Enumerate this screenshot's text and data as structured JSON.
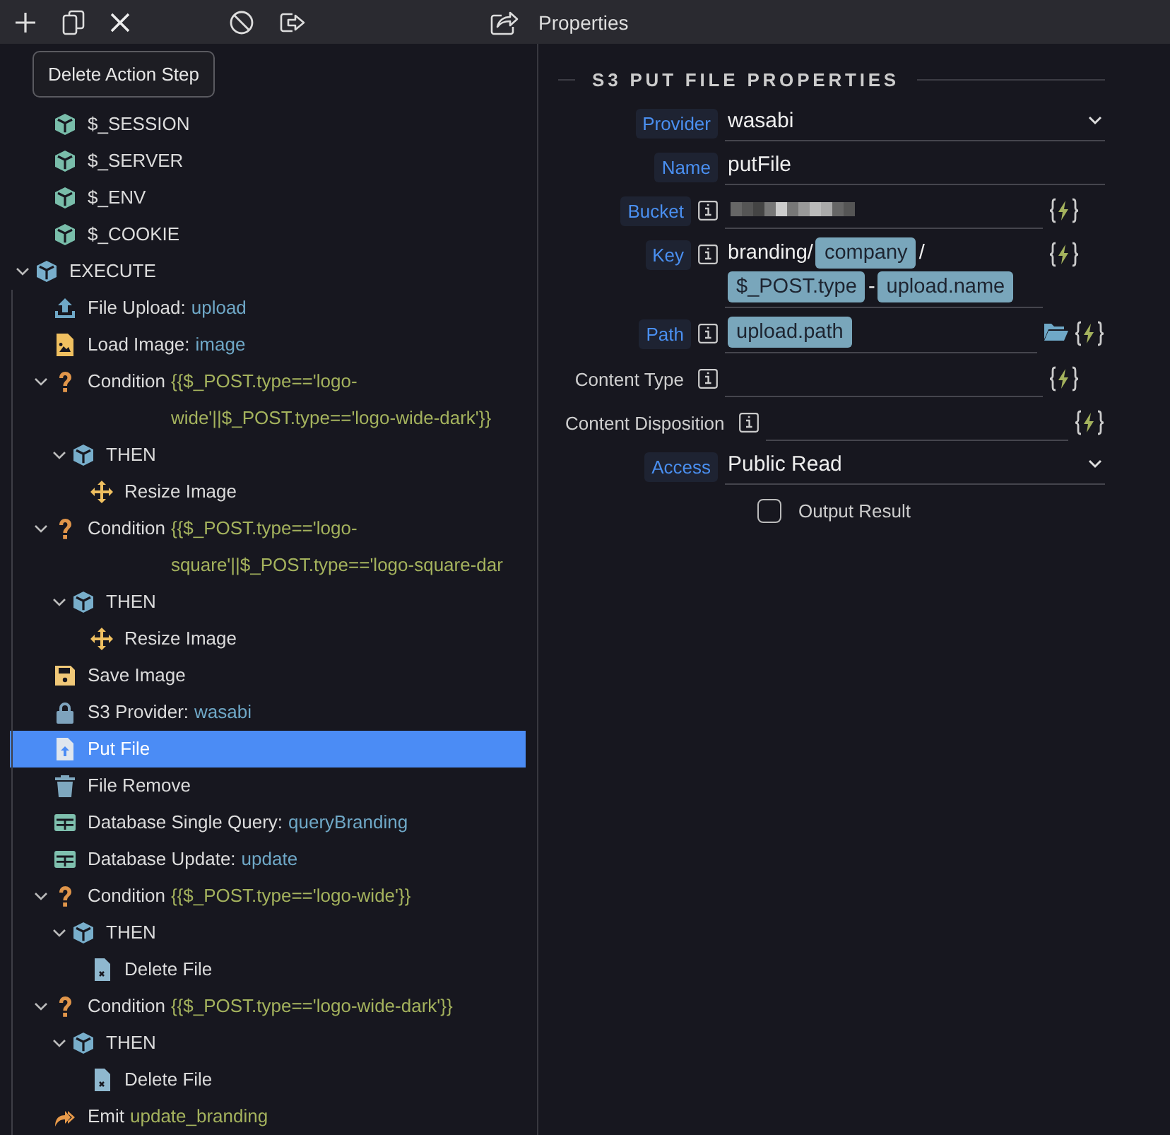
{
  "toolbar": {
    "tooltip": "Delete Action Step",
    "panel_title": "Properties"
  },
  "globals": [
    {
      "kind": "variables",
      "label": "$_SESSION",
      "selected": false
    },
    {
      "kind": "variables",
      "label": "$_SERVER",
      "selected": false
    },
    {
      "kind": "variables",
      "label": "$_ENV",
      "selected": false
    },
    {
      "kind": "variables",
      "label": "$_COOKIE",
      "selected": false
    }
  ],
  "tree": [
    {
      "kind": "group",
      "label": "EXECUTE",
      "selected": false,
      "expanded": true,
      "children": [
        {
          "kind": "upload",
          "label": "File Upload:",
          "value": "upload",
          "expression": false,
          "selected": false
        },
        {
          "kind": "image",
          "label": "Load Image:",
          "value": "image",
          "expression": false,
          "selected": false
        },
        {
          "kind": "condition",
          "label": "Condition",
          "value": "{{$_POST.type=='logo-wide'||$_POST.type=='logo-wide-dark'}}",
          "expression": true,
          "selected": false,
          "expanded": true,
          "children": [
            {
              "kind": "group",
              "label": "THEN",
              "selected": false,
              "expanded": true,
              "children": [
                {
                  "kind": "resize",
                  "label": "Resize Image",
                  "selected": false
                }
              ]
            }
          ]
        },
        {
          "kind": "condition",
          "label": "Condition",
          "value": "{{$_POST.type=='logo-square'||$_POST.type=='logo-square-dar",
          "expression": true,
          "selected": false,
          "expanded": true,
          "children": [
            {
              "kind": "group",
              "label": "THEN",
              "selected": false,
              "expanded": true,
              "children": [
                {
                  "kind": "resize",
                  "label": "Resize Image",
                  "selected": false
                }
              ]
            }
          ]
        },
        {
          "kind": "save",
          "label": "Save Image",
          "selected": false
        },
        {
          "kind": "lock",
          "label": "S3 Provider:",
          "value": "wasabi",
          "expression": false,
          "selected": false
        },
        {
          "kind": "putfile",
          "label": "Put File",
          "selected": true
        },
        {
          "kind": "trash",
          "label": "File Remove",
          "selected": false
        },
        {
          "kind": "table",
          "label": "Database Single Query:",
          "value": "queryBranding",
          "expression": false,
          "selected": false
        },
        {
          "kind": "table",
          "label": "Database Update:",
          "value": "update",
          "expression": false,
          "selected": false
        },
        {
          "kind": "condition",
          "label": "Condition",
          "value": "{{$_POST.type=='logo-wide'}}",
          "expression": true,
          "selected": false,
          "expanded": true,
          "children": [
            {
              "kind": "group",
              "label": "THEN",
              "selected": false,
              "expanded": true,
              "children": [
                {
                  "kind": "deletefile",
                  "label": "Delete File",
                  "selected": false
                }
              ]
            }
          ]
        },
        {
          "kind": "condition",
          "label": "Condition",
          "value": "{{$_POST.type=='logo-wide-dark'}}",
          "expression": true,
          "selected": false,
          "expanded": true,
          "children": [
            {
              "kind": "group",
              "label": "THEN",
              "selected": false,
              "expanded": true,
              "children": [
                {
                  "kind": "deletefile",
                  "label": "Delete File",
                  "selected": false
                }
              ]
            }
          ]
        },
        {
          "kind": "emit",
          "label": "Emit",
          "value": "update_branding",
          "expression": true,
          "selected": false
        }
      ]
    }
  ],
  "properties": {
    "title": "S3 PUT FILE PROPERTIES",
    "fields": [
      {
        "label": "Provider",
        "bound": true,
        "kind": "select",
        "value": "wasabi"
      },
      {
        "label": "Name",
        "bound": true,
        "kind": "text",
        "value": "putFile"
      },
      {
        "label": "Bucket",
        "bound": true,
        "info": true,
        "dynamic": true,
        "kind": "redacted"
      },
      {
        "label": "Key",
        "bound": true,
        "info": true,
        "dynamic": true,
        "kind": "tokens",
        "parts": [
          {
            "text": "branding/",
            "token": false
          },
          {
            "text": "company",
            "token": true
          },
          {
            "text": "/",
            "token": false
          },
          {
            "text": "$_POST.type",
            "token": true
          },
          {
            "text": "-",
            "token": false
          },
          {
            "text": "upload.name",
            "token": true
          }
        ]
      },
      {
        "label": "Path",
        "bound": true,
        "info": true,
        "dynamic": true,
        "folder": true,
        "kind": "tokens",
        "parts": [
          {
            "text": "upload.path",
            "token": true
          }
        ]
      },
      {
        "label": "Content Type",
        "bound": false,
        "info": true,
        "dynamic": true,
        "kind": "empty"
      },
      {
        "label": "Content Disposition",
        "bound": false,
        "info": true,
        "dynamic": true,
        "kind": "empty"
      },
      {
        "label": "Access",
        "bound": true,
        "kind": "select",
        "value": "Public Read"
      }
    ],
    "output": {
      "label": "Output Result",
      "checked": false
    }
  }
}
